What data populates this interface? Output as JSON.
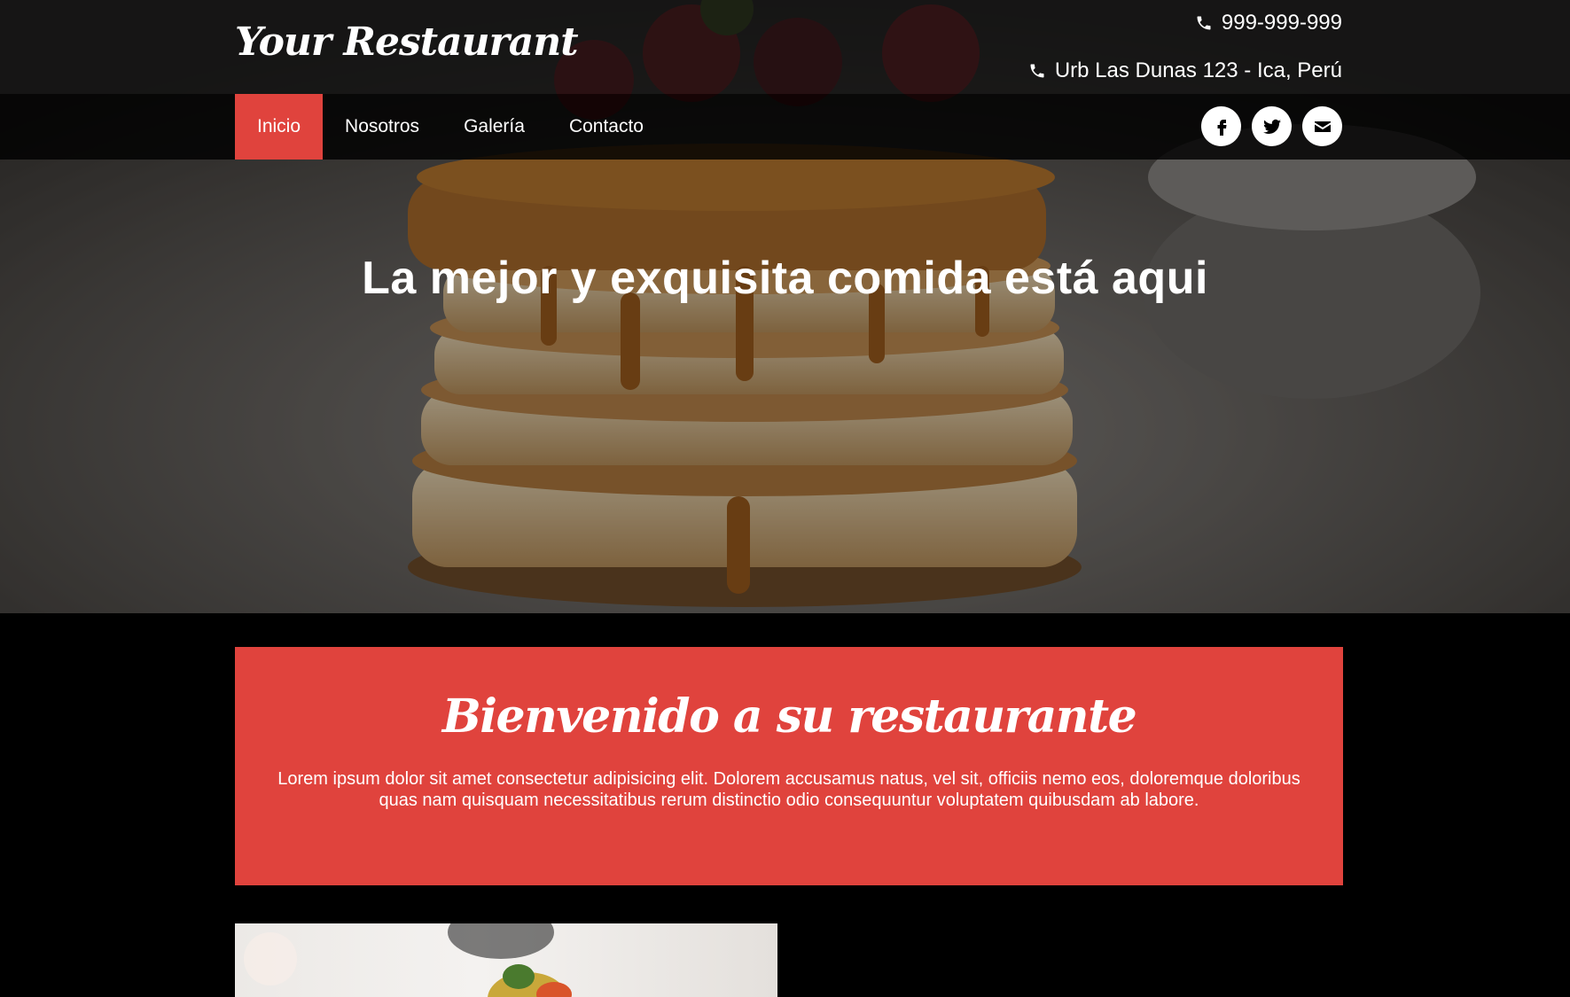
{
  "header": {
    "logo": "Your Restaurant",
    "phone": "999-999-999",
    "address": "Urb Las Dunas 123 - Ica, Perú"
  },
  "nav": {
    "items": [
      {
        "label": "Inicio",
        "active": true
      },
      {
        "label": "Nosotros",
        "active": false
      },
      {
        "label": "Galería",
        "active": false
      },
      {
        "label": "Contacto",
        "active": false
      }
    ],
    "socials": [
      "facebook-icon",
      "twitter-icon",
      "envelope-icon"
    ]
  },
  "hero": {
    "headline": "La mejor y exquisita comida está aqui"
  },
  "welcome": {
    "title": "Bienvenido a su restaurante",
    "text": "Lorem ipsum dolor sit amet consectetur adipisicing elit. Dolorem accusamus natus, vel sit, officiis nemo eos, doloremque doloribus quas nam quisquam necessitatibus rerum distinctio odio consequuntur voluptatem quibusdam ab labore."
  },
  "colors": {
    "accent": "#e0433d",
    "background": "#000000"
  }
}
